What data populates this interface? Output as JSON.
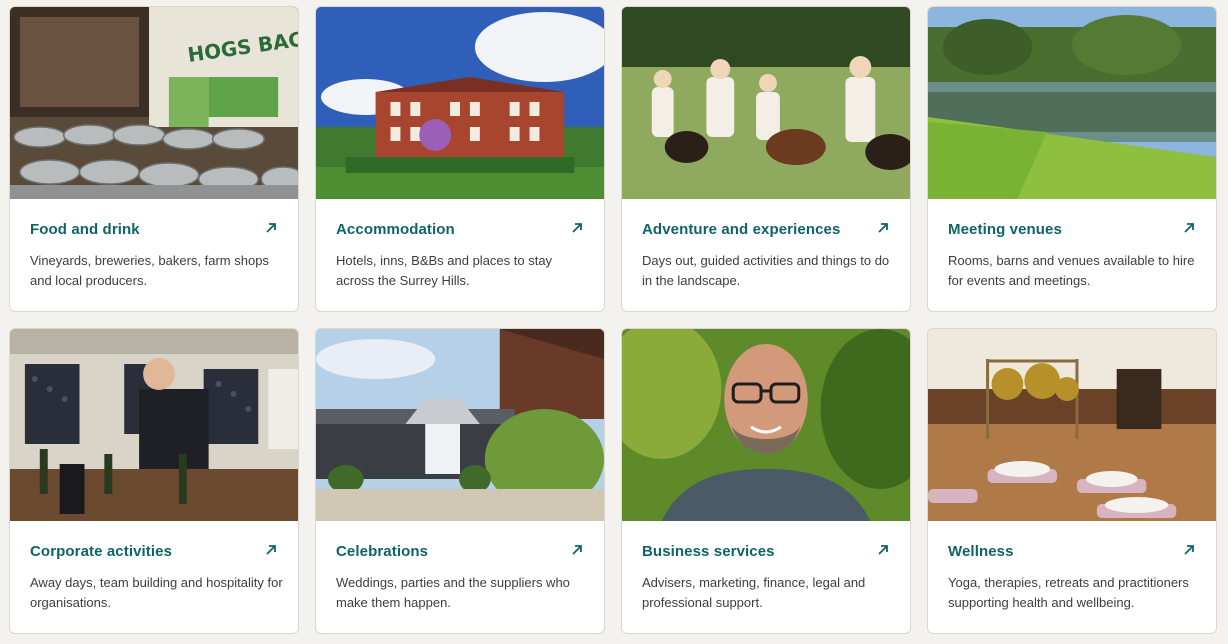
{
  "cards": [
    {
      "title": "Food and drink",
      "description": "Vineyards, breweries, bakers, farm shops and local producers.",
      "image": "kegs-and-brewery-truck-photo",
      "icon": "arrow-up-right-icon"
    },
    {
      "title": "Accommodation",
      "description": "Hotels, inns, B&Bs and places to stay across the Surrey Hills.",
      "image": "red-brick-country-hotel-photo",
      "icon": "arrow-up-right-icon"
    },
    {
      "title": "Adventure and experiences",
      "description": "Days out, guided activities and things to do in the landscape.",
      "image": "girls-leading-ponies-photo",
      "icon": "arrow-up-right-icon"
    },
    {
      "title": "Meeting venues",
      "description": "Rooms, barns and venues available to hire for events and meetings.",
      "image": "lakeside-lawn-photo",
      "icon": "arrow-up-right-icon"
    },
    {
      "title": "Corporate activities",
      "description": "Away days, team building and hospitality for organisations.",
      "image": "wine-tasting-cellar-photo",
      "icon": "arrow-up-right-icon"
    },
    {
      "title": "Celebrations",
      "description": "Weddings, parties and the suppliers who make them happen.",
      "image": "barn-wedding-venue-photo",
      "icon": "arrow-up-right-icon"
    },
    {
      "title": "Business services",
      "description": "Advisers, marketing, finance, legal and professional support.",
      "image": "smiling-man-portrait-photo",
      "icon": "arrow-up-right-icon"
    },
    {
      "title": "Wellness",
      "description": "Yoga, therapies, retreats and practitioners supporting health and wellbeing.",
      "image": "gong-bath-yoga-photo",
      "icon": "arrow-up-right-icon"
    }
  ],
  "colors": {
    "title": "#0f6466",
    "text": "#3d3d3d",
    "page_background": "#f3f2ee",
    "card_border": "#d9d7d0"
  }
}
